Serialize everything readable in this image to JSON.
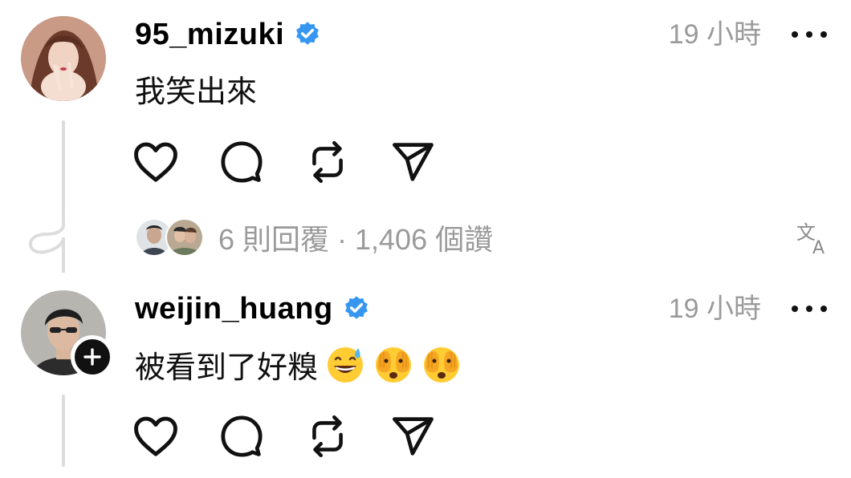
{
  "comments": [
    {
      "username": "95_mizuki",
      "time": "19 小時",
      "text": "我笑出來",
      "verified": true,
      "replies_summary": "6 則回覆 · 1,406 個讚"
    },
    {
      "username": "weijin_huang",
      "time": "19 小時",
      "text": "被看到了好糗",
      "verified": true,
      "emojis": [
        "grinning-sweat",
        "face-with-hands-over-eyes",
        "face-with-hands-over-eyes"
      ]
    }
  ],
  "colors": {
    "verified": "#3797f0",
    "muted": "#9a9a9a",
    "thread_line": "#dcdcdc"
  },
  "icons": [
    "heart-icon",
    "comment-icon",
    "repost-icon",
    "share-icon",
    "translate-icon",
    "more-icon",
    "verified-icon",
    "plus-icon"
  ]
}
